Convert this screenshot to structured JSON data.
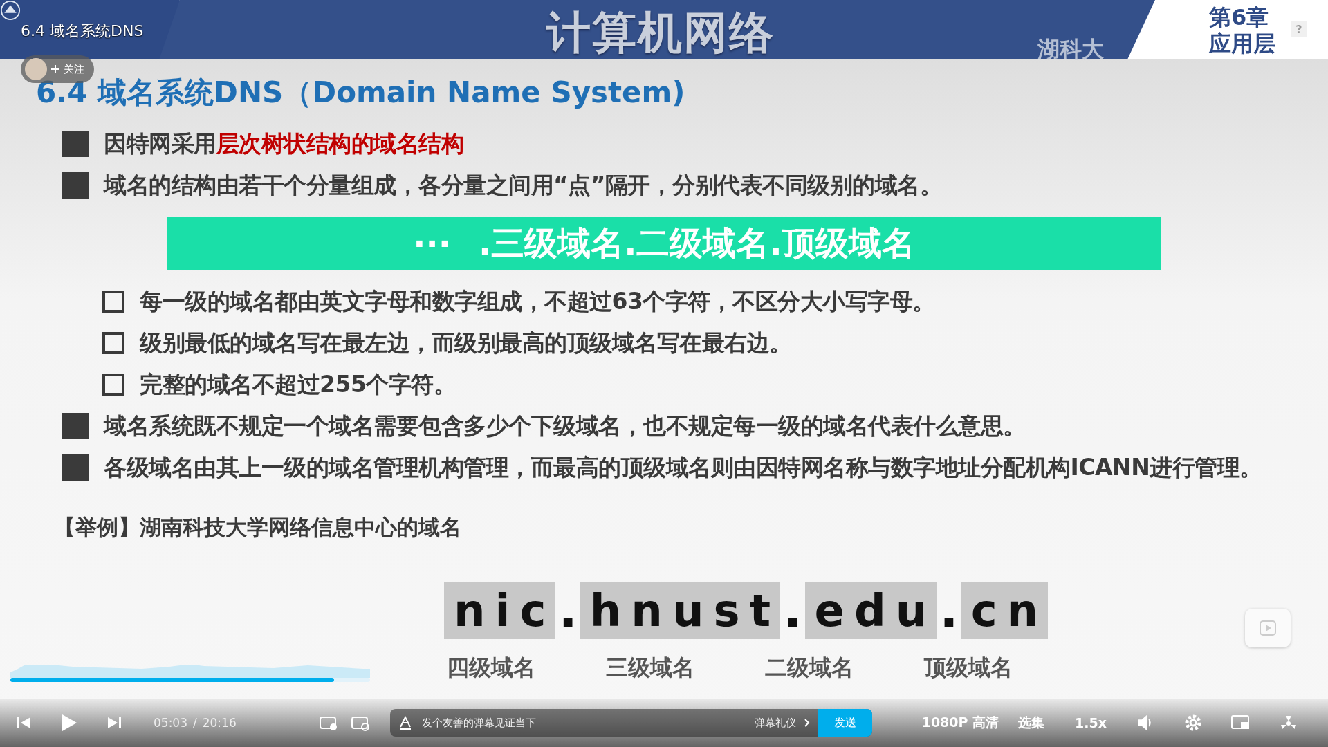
{
  "video_title": "6.4 域名系统DNS",
  "follow_button": "关注",
  "slide": {
    "header_title": "计算机网络",
    "header_subtitle": "湖科大",
    "chapter": "第6章",
    "chapter_sub": "应用层",
    "heading": "6.4 域名系统DNS（Domain Name System)",
    "bullets": [
      {
        "kind": "square",
        "text": "因特网采用",
        "highlight": "层次树状结构的域名结构"
      },
      {
        "kind": "square",
        "text": "域名的结构由若干个分量组成，各分量之间用“点”隔开，分别代表不同级别的域名。"
      },
      {
        "kind": "banner",
        "ellipsis": "···",
        "text": ".三级域名.二级域名.顶级域名"
      },
      {
        "kind": "checkbox",
        "text": "每一级的域名都由英文字母和数字组成，不超过63个字符，不区分大小写字母。"
      },
      {
        "kind": "checkbox",
        "text": "级别最低的域名写在最左边，而级别最高的顶级域名写在最右边。"
      },
      {
        "kind": "checkbox",
        "text": "完整的域名不超过255个字符。"
      },
      {
        "kind": "square",
        "text": "域名系统既不规定一个域名需要包含多少个下级域名，也不规定每一级的域名代表什么意思。"
      },
      {
        "kind": "square",
        "text": "各级域名由其上一级的域名管理机构管理，而最高的顶级域名则由因特网名称与数字地址分配机构ICANN进行管理。"
      }
    ],
    "example": "【举例】湖南科技大学网络信息中心的域名",
    "domain_parts": [
      "nic",
      "hnust",
      "edu",
      "cn"
    ],
    "domain_separator": ".",
    "level_labels": [
      "四级域名",
      "三级域名",
      "二级域名",
      "顶级域名"
    ]
  },
  "help_badge": "?",
  "player": {
    "progress": {
      "level": 0.9
    },
    "time_current": "05:03",
    "time_separator": "/",
    "time_total": "20:16",
    "danmaku_placeholder": "发个友善的弹幕见证当下",
    "etiquette": "弹幕礼仪",
    "send": "发送",
    "quality": "1080P 高清",
    "episodes": "选集",
    "speed": "1.5x"
  }
}
